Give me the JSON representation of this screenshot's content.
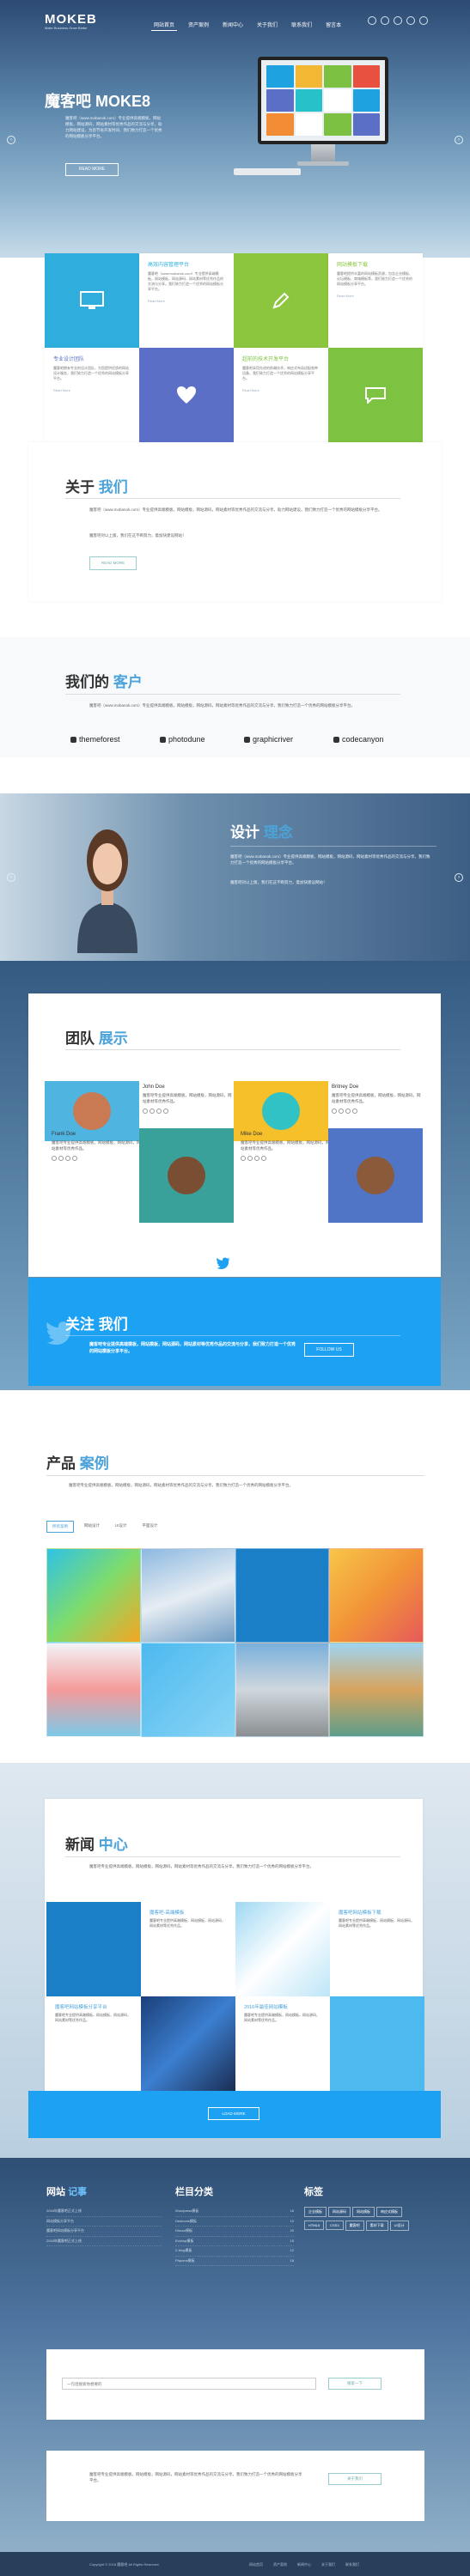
{
  "header": {
    "logo": "MOKEB",
    "logo_sub": "Make Business Grow Better",
    "nav": [
      "网站首页",
      "资产案例",
      "新闻中心",
      "关于我们",
      "联系我们",
      "留言本"
    ],
    "active": "网站首页"
  },
  "hero": {
    "title": "魔客吧 MOKE8",
    "desc": "魔客吧（www.mobanok.com）专业提供高端模板，网站模板，网站源码，网站素材等优秀作品的交流与分享，助力网站建设，为您节省开发时间，我们致力打造一个优秀的网站模板分享平台。",
    "button": "READ MORE",
    "prev": "‹",
    "next": "›"
  },
  "tiles": [
    {
      "title": "高效内容管理平台",
      "desc": "魔客吧（www.mobanok.com）专业提供高端模板，网站模板，网站源码，网站素材等优秀作品的交流与分享。我们致力打造一个优秀的网站模板分享平台。",
      "more": "Read More",
      "icon": "monitor-icon",
      "color": "#2faede"
    },
    {
      "title": "网站模板下载",
      "desc": "魔客吧提供丰富的网站模板资源，包含企业模板、论坛模板、商城模板等，我们致力打造一个优秀的网站模板分享平台。",
      "more": "Read More",
      "icon": "pencil-icon",
      "color": "#8cc63f"
    },
    {
      "title": "专业设计团队",
      "desc": "魔客吧拥有专业的设计团队，为您提供优质的网站设计服务，我们致力打造一个优秀的网站模板分享平台。",
      "more": "Read More",
      "icon": "heart-icon",
      "color": "#5b6fc7"
    },
    {
      "title": "超前的技术开发平台",
      "desc": "魔客吧采用先进的前端技术，响应式布局适配各种设备，我们致力打造一个优秀的网站模板分享平台。",
      "more": "Read More",
      "icon": "chat-icon",
      "color": "#7ec241"
    }
  ],
  "about": {
    "t1": "关于",
    "t2": "我们",
    "p1": "魔客吧（www.mobanok.com）专业提供高端模板，网站模板，网站源码，网站素材等优秀作品的交流与分享，助力网站建设，我们致力打造一个优秀的网站模板分享平台。",
    "p2": "魔客吧对以上版，我们在这不断努力，着加快建设网站！",
    "button": "READ MORE"
  },
  "clients": {
    "t1": "我们的",
    "t2": "客户",
    "p": "魔客吧（www.mobanok.com）专业提供高端模板，网站模板，网站源码，网站素材等优秀作品的交流与分享，我们致力打造一个优秀的网站模板分享平台。",
    "brands": [
      "themeforest",
      "photodune",
      "graphicriver",
      "codecanyon"
    ]
  },
  "design": {
    "t1": "设计",
    "t2": "理念",
    "p": "魔客吧（www.mobanok.com）专业提供高端模板，网站模板，网站源码，网站素材等优秀作品的交流与分享。我们致力打造一个优秀的网站模板分享平台。",
    "p2": "魔客吧对以上版，我们在这不断努力，着加快建设网站！"
  },
  "team": {
    "t1": "团队",
    "t2": "展示",
    "members": [
      {
        "name": "John Doe",
        "desc": "魔客吧专业提供高端模板，网站模板，网站源码，网站素材等优秀作品。",
        "bg": "#4fb4e0",
        "face": "#c97a52"
      },
      {
        "name": "Britney Doe",
        "desc": "魔客吧专业提供高端模板，网站模板，网站源码，网站素材等优秀作品。",
        "bg": "#f5c02a",
        "face": "#31c2c6"
      },
      {
        "name": "Frank Doe",
        "desc": "魔客吧专业提供高端模板，网站模板，网站源码，网站素材等优秀作品。",
        "bg": "#3aa09a",
        "face": "#7a4e32"
      },
      {
        "name": "Mike Doe",
        "desc": "魔客吧专业提供高端模板，网站模板，网站源码，网站素材等优秀作品。",
        "bg": "#5175c6",
        "face": "#8a5a3b"
      }
    ]
  },
  "follow": {
    "t1": "关注",
    "t2": "我们",
    "p": "魔客吧专业提供高端模板，网站模板，网站源码，网站素材等优秀作品的交流与分享，我们致力打造一个优秀的网站模板分享平台。",
    "button": "FOLLOW US"
  },
  "products": {
    "t1": "产品",
    "t2": "案例",
    "p": "魔客吧专业提供高端模板，网站模板，网站源码，网站素材等优秀作品的交流与分享，我们致力打造一个优秀的网站模板分享平台。",
    "filters": [
      "所有案例",
      "网站设计",
      "UI设计",
      "平面设计"
    ],
    "colors": [
      "#1f9bd8",
      "#5e9ed5",
      "#1a7fc7",
      "#f0a02f",
      "#e6ebf2",
      "#5ab7e9",
      "#9fb8cf",
      "#6fb0cf"
    ]
  },
  "news": {
    "t1": "新闻",
    "t2": "中心",
    "p": "魔客吧专业提供高端模板，网站模板，网站源码，网站素材等优秀作品的交流与分享，我们致力打造一个优秀的网站模板分享平台。",
    "items": [
      {
        "title": "魔客吧-高端模板",
        "desc": "魔客吧专业提供高端模板，网站模板，网站源码，网站素材等优秀作品。"
      },
      {
        "title": "魔客吧网站模板下载",
        "desc": "魔客吧专业提供高端模板，网站模板，网站源码，网站素材等优秀作品。"
      },
      {
        "title": "魔客吧网站模板分享平台",
        "desc": "魔客吧专业提供高端模板，网站模板，网站源码，网站素材等优秀作品。"
      },
      {
        "title": "2016年最佳网站模板",
        "desc": "魔客吧专业提供高端模板，网站模板，网站源码，网站素材等优秀作品。"
      }
    ],
    "button": "LOAD MORE"
  },
  "footer": {
    "col1_t1": "网站",
    "col1_t2": "记事",
    "notes": [
      "2016年魔客吧正式上线",
      "网站模板分享平台",
      "魔客吧网站模板分享平台",
      "2016年魔客吧正式上线"
    ],
    "col2": "栏目分类",
    "cats": [
      [
        "Wordpress模板",
        "16"
      ],
      [
        "Dedecms模板",
        "10"
      ],
      [
        "Discuz模板",
        "20"
      ],
      [
        "Ecshop模板",
        "15"
      ],
      [
        "Z-blog模板",
        "12"
      ],
      [
        "Phpcms模板",
        "18"
      ]
    ],
    "col3": "标签",
    "tags": [
      "企业模板",
      "网站源码",
      "网站模板",
      "响应式模板",
      "HTML5",
      "CSS3",
      "魔客吧",
      "素材下载",
      "UI设计"
    ],
    "search_ph": "一句话搜索你想要的",
    "search_btn": "搜索一下",
    "about": "魔客吧专业提供高端模板，网站模板，网站源码，网站素材等优秀作品的交流与分享，我们致力打造一个优秀的网站模板分享平台。",
    "about_btn": "关于我们",
    "copyright": "Copyright © 2016 魔客吧 All Rights Reserved.",
    "links": [
      "网站首页",
      "资产案例",
      "新闻中心",
      "关于我们",
      "联系我们"
    ]
  }
}
